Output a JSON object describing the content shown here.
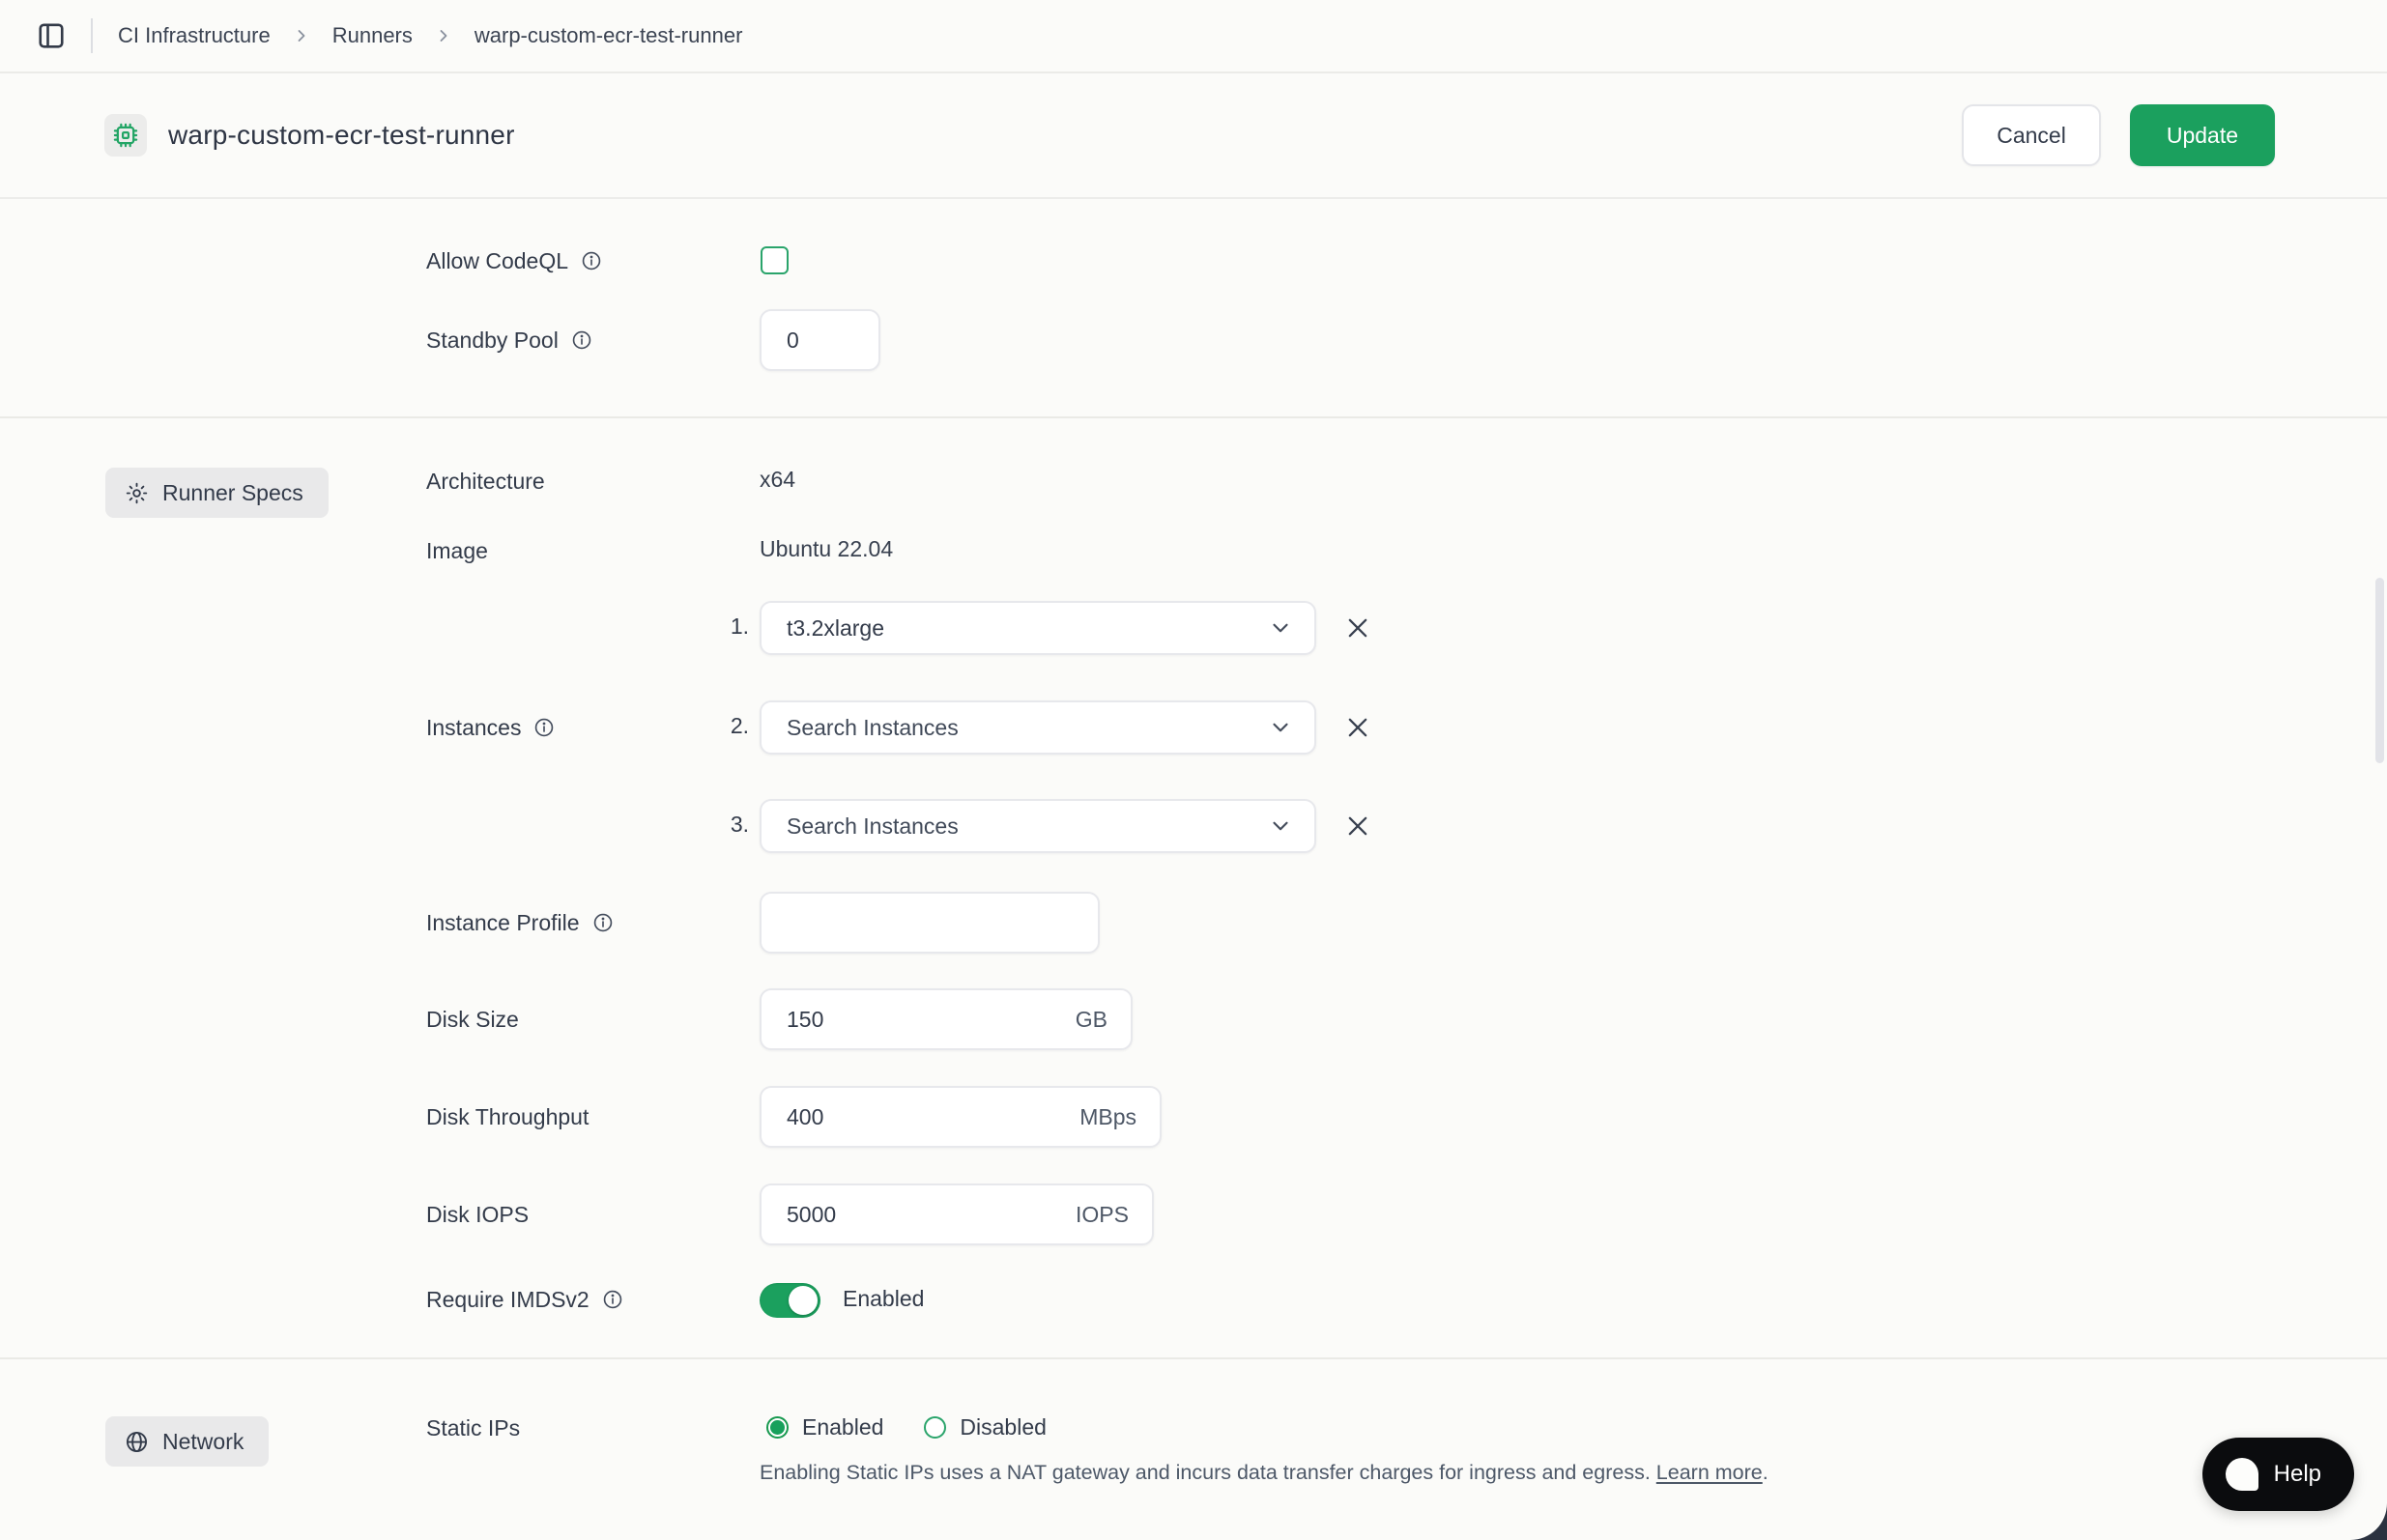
{
  "breadcrumb": {
    "items": [
      "CI Infrastructure",
      "Runners",
      "warp-custom-ecr-test-runner"
    ]
  },
  "header": {
    "title": "warp-custom-ecr-test-runner",
    "cancel_label": "Cancel",
    "update_label": "Update"
  },
  "general": {
    "allow_codeql_label": "Allow CodeQL",
    "standby_pool_label": "Standby Pool",
    "standby_pool_value": "0"
  },
  "runner_specs": {
    "badge_label": "Runner Specs",
    "architecture_label": "Architecture",
    "architecture_value": "x64",
    "image_label": "Image",
    "image_value": "Ubuntu 22.04",
    "instances_label": "Instances",
    "instances": [
      {
        "index": "1.",
        "value": "t3.2xlarge"
      },
      {
        "index": "2.",
        "value": "Search Instances"
      },
      {
        "index": "3.",
        "value": "Search Instances"
      }
    ],
    "instance_profile_label": "Instance Profile",
    "instance_profile_value": "",
    "disk_size_label": "Disk Size",
    "disk_size_value": "150",
    "disk_size_unit": "GB",
    "disk_throughput_label": "Disk Throughput",
    "disk_throughput_value": "400",
    "disk_throughput_unit": "MBps",
    "disk_iops_label": "Disk IOPS",
    "disk_iops_value": "5000",
    "disk_iops_unit": "IOPS",
    "imdsv2_label": "Require IMDSv2",
    "imdsv2_state": "Enabled"
  },
  "network": {
    "badge_label": "Network",
    "static_ips_label": "Static IPs",
    "enabled_label": "Enabled",
    "disabled_label": "Disabled",
    "help_text": "Enabling Static IPs uses a NAT gateway and incurs data transfer charges for ingress and egress. ",
    "learn_more_label": "Learn more",
    "period": "."
  },
  "help_button": {
    "label": "Help"
  },
  "colors": {
    "accent_green": "#1ba05e",
    "badge_bg": "#e9e9ea",
    "page_bg": "#fbfbf9"
  }
}
